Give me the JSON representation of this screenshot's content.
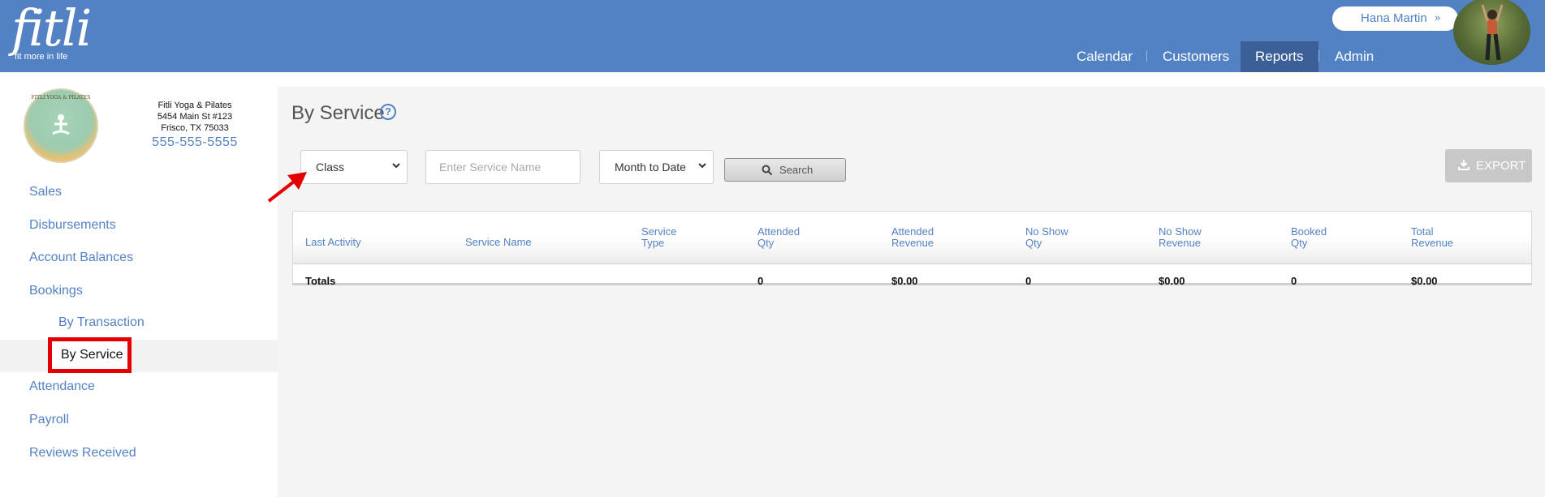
{
  "header": {
    "logo_text": "fitli",
    "logo_tagline": "fit more in life",
    "user_name": "Hana Martin",
    "nav": [
      "Calendar",
      "Customers",
      "Reports",
      "Admin"
    ],
    "active_nav": "Reports"
  },
  "business": {
    "logo_text": "FITLI YOGA & PILATES",
    "name": "Fitli Yoga & Pilates",
    "address1": "5454 Main St #123",
    "address2": "Frisco, TX 75033",
    "phone": "555-555-5555"
  },
  "sidebar": {
    "items": [
      "Sales",
      "Disbursements",
      "Account Balances",
      "Bookings"
    ],
    "sub_items": [
      "By Transaction",
      "By Service"
    ],
    "bottom_items": [
      "Attendance",
      "Payroll",
      "Reviews Received"
    ],
    "active": "By Service"
  },
  "page": {
    "title": "By Service",
    "help_symbol": "?"
  },
  "filters": {
    "type_value": "Class",
    "service_placeholder": "Enter Service Name",
    "period_value": "Month to Date",
    "search_label": "Search",
    "export_label": "EXPORT"
  },
  "table": {
    "headers": [
      [
        "Last Activity",
        ""
      ],
      [
        "Service Name",
        ""
      ],
      [
        "Service",
        "Type"
      ],
      [
        "Attended",
        "Qty"
      ],
      [
        "Attended",
        "Revenue"
      ],
      [
        "No Show",
        "Qty"
      ],
      [
        "No Show",
        "Revenue"
      ],
      [
        "Booked",
        "Qty"
      ],
      [
        "Total",
        "Revenue"
      ]
    ],
    "totals_label": "Totals",
    "totals": [
      "0",
      "$0.00",
      "0",
      "$0.00",
      "0",
      "$0.00"
    ]
  },
  "colors": {
    "brand_blue": "#5382c4",
    "nav_active": "#3b5f97",
    "highlight_red": "#e20000"
  }
}
